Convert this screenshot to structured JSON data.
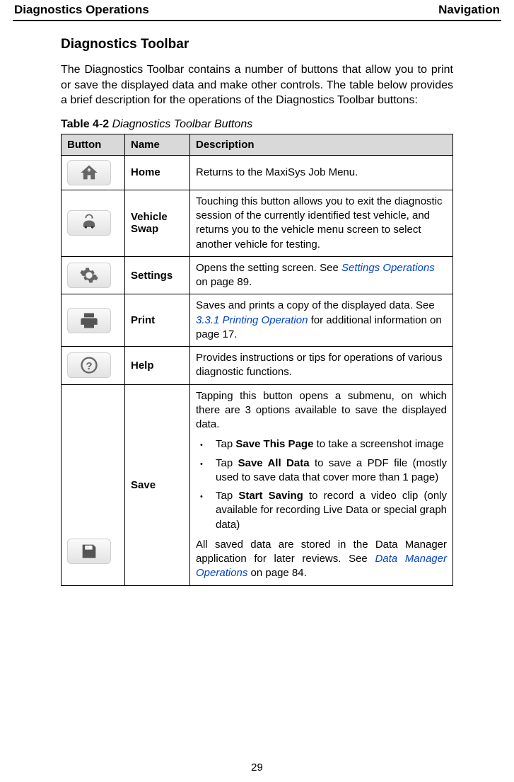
{
  "header": {
    "left": "Diagnostics Operations",
    "right": "Navigation"
  },
  "section": {
    "heading": "Diagnostics Toolbar",
    "intro": "The Diagnostics Toolbar contains a number of buttons that allow you to print or save the displayed data and make other controls. The table below provides a brief description for the operations of the Diagnostics Toolbar buttons:"
  },
  "table_caption": {
    "label": "Table 4-2",
    "text": "Diagnostics Toolbar Buttons"
  },
  "table_headers": {
    "button": "Button",
    "name": "Name",
    "description": "Description"
  },
  "rows": {
    "home": {
      "name": "Home",
      "desc": "Returns to the MaxiSys Job Menu."
    },
    "vehicle_swap": {
      "name": "Vehicle Swap",
      "desc": "Touching this button allows you to exit the diagnostic session of the currently identified test vehicle, and returns you to the vehicle menu screen to select another vehicle for testing."
    },
    "settings": {
      "name": "Settings",
      "desc_before": "Opens the setting screen. See ",
      "link": "Settings Operations",
      "desc_after": " on page 89."
    },
    "print": {
      "name": "Print",
      "desc_before": "Saves and prints a copy of the displayed data. See ",
      "link": "3.3.1 Printing Operation",
      "desc_after": " for additional information on page 17."
    },
    "help": {
      "name": "Help",
      "desc": "Provides instructions or tips for operations of various diagnostic functions."
    },
    "save": {
      "name": "Save",
      "intro": "Tapping this button opens a submenu, on which there are 3 options available to save the displayed data.",
      "bullet1_before": "Tap ",
      "bullet1_bold": "Save This Page",
      "bullet1_after": " to take a screenshot image",
      "bullet2_before": "Tap ",
      "bullet2_bold": "Save All Data",
      "bullet2_after": " to save a PDF file (mostly used to save data that cover more than 1 page)",
      "bullet3_before": "Tap ",
      "bullet3_bold": "Start Saving",
      "bullet3_after": " to record a video clip (only available for recording Live Data or special graph data)",
      "outro_before": "All saved data are stored in the Data Manager application for later reviews. See ",
      "outro_link": "Data Manager Operations",
      "outro_after": " on page 84."
    }
  },
  "page_number": "29"
}
